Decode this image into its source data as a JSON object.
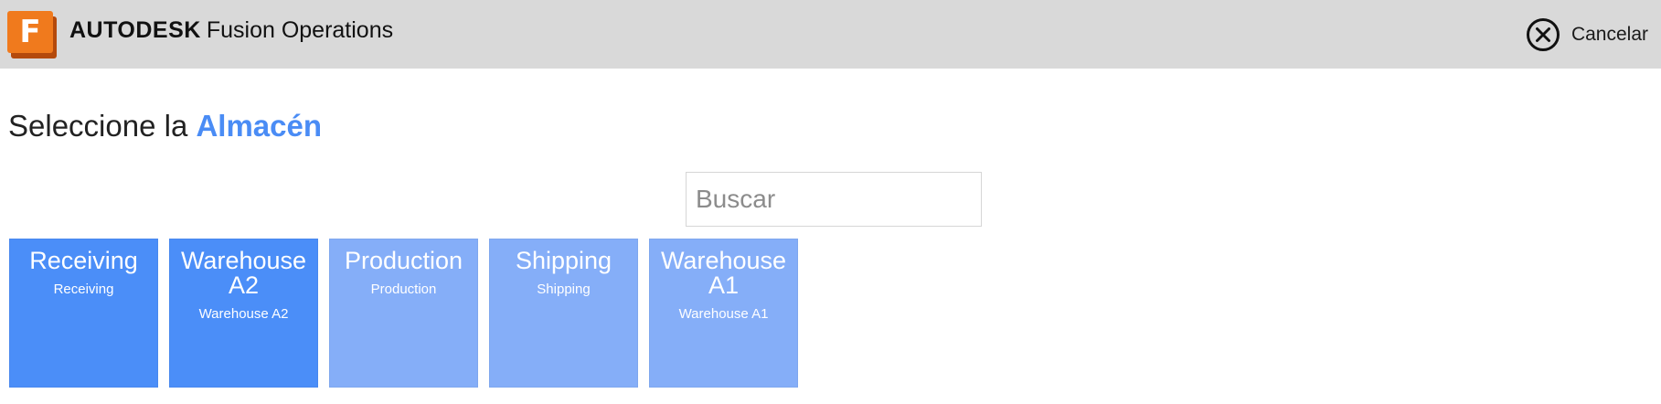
{
  "header": {
    "logo_letter": "F",
    "brand_strong": "AUTODESK",
    "brand_rest": "Fusion Operations",
    "cancel_label": "Cancelar"
  },
  "page": {
    "heading_prefix": "Seleccione la",
    "heading_highlight": "Almacén"
  },
  "search": {
    "placeholder": "Buscar",
    "value": ""
  },
  "tiles": [
    {
      "title": "Receiving",
      "subtitle": "Receiving",
      "state": "selected"
    },
    {
      "title": "Warehouse A2",
      "subtitle": "Warehouse A2",
      "state": "selected"
    },
    {
      "title": "Production",
      "subtitle": "Production",
      "state": "light"
    },
    {
      "title": "Shipping",
      "subtitle": "Shipping",
      "state": "light"
    },
    {
      "title": "Warehouse A1",
      "subtitle": "Warehouse A1",
      "state": "light"
    }
  ],
  "colors": {
    "topbar": "#d9d9d9",
    "accent": "#4a8cf5",
    "tile_selected": "#4b8ef8",
    "tile_light": "#85aef8",
    "logo_orange": "#f07a1d"
  },
  "icons": {
    "cancel": "close-circle-icon",
    "logo": "fusion-logo-icon"
  }
}
